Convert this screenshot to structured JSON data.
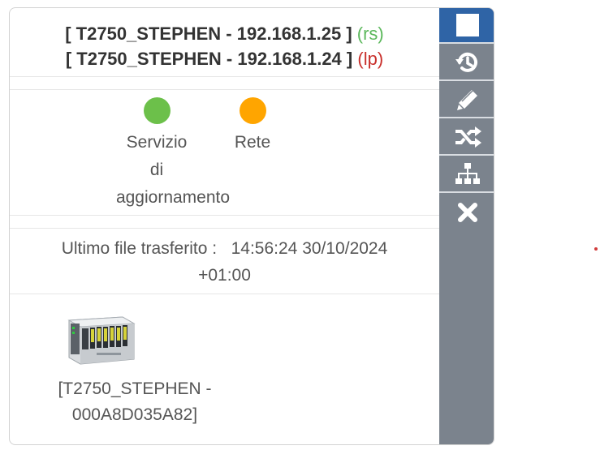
{
  "header": {
    "line1": {
      "host": "[ T2750_STEPHEN - 192.168.1.25 ]",
      "tag": "(rs)",
      "tag_color": "#5cb85c"
    },
    "line2": {
      "host": "[ T2750_STEPHEN - 192.168.1.24 ]",
      "tag": "(lp)",
      "tag_color": "#c9302c"
    }
  },
  "status": [
    {
      "label_lines": [
        "Servizio",
        "di",
        "aggiornamento"
      ],
      "color": "#6cc04a"
    },
    {
      "label_lines": [
        "Rete"
      ],
      "color": "#ffa500"
    }
  ],
  "transfer": {
    "label": "Ultimo file trasferito :",
    "time": "14:56:24 30/10/2024",
    "tz": "+01:00"
  },
  "device": {
    "label_line1": "[T2750_STEPHEN -",
    "label_line2": "000A8D035A82]"
  },
  "sidebar": {
    "buttons": [
      {
        "name": "stop-icon",
        "active": true
      },
      {
        "name": "history-icon",
        "active": false
      },
      {
        "name": "pencil-icon",
        "active": false
      },
      {
        "name": "shuffle-icon",
        "active": false
      },
      {
        "name": "sitemap-icon",
        "active": false
      },
      {
        "name": "close-icon",
        "active": false
      }
    ]
  },
  "colors": {
    "sidebar": "#7b838d",
    "active_button": "#2f64a6"
  }
}
